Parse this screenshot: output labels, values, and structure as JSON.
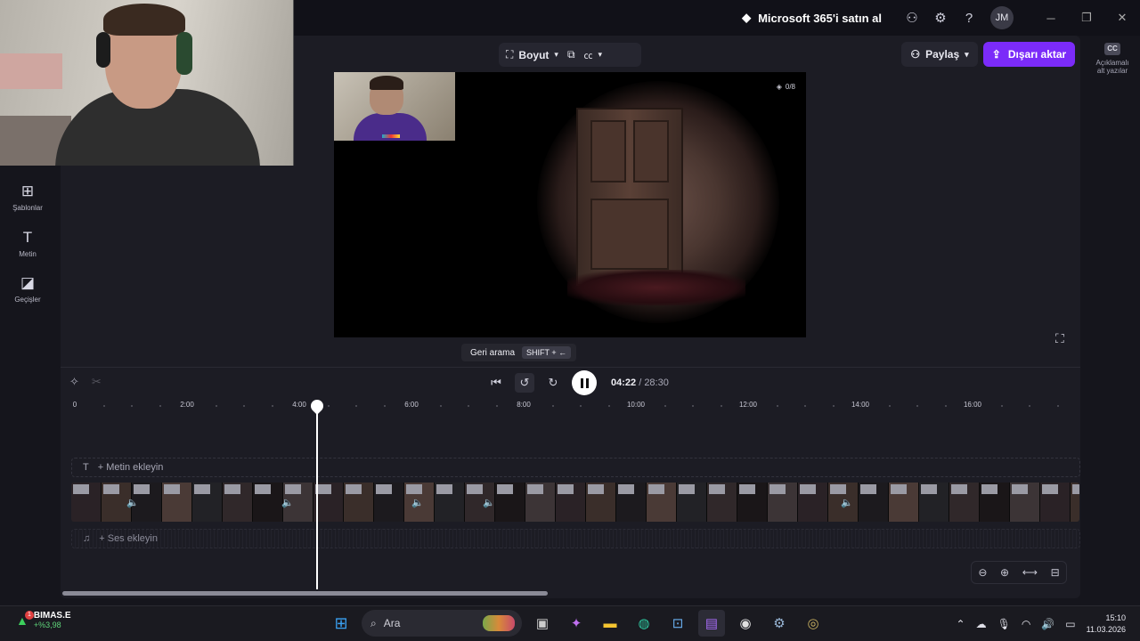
{
  "titlebar": {
    "ms365_label": "Microsoft 365'i satın al",
    "avatar_initials": "JM"
  },
  "rail": {
    "items": [
      {
        "label": "Şablonlar",
        "icon": "templates-icon"
      },
      {
        "label": "Metin",
        "icon": "text-icon"
      },
      {
        "label": "Geçişler",
        "icon": "transitions-icon"
      }
    ]
  },
  "right_rail": {
    "cc_badge": "CC",
    "cc_label": "Açıklamalı alt yazılar"
  },
  "toolbar": {
    "size_label": "Boyut",
    "share_label": "Paylaş",
    "export_label": "Dışarı aktar"
  },
  "preview": {
    "badge_text": "0/8"
  },
  "tooltip": {
    "label": "Geri arama",
    "shortcut": "SHIFT + ←"
  },
  "playback": {
    "current_time": "04:22",
    "duration": "/ 28:30",
    "rewind_seconds": "5",
    "forward_seconds": "5",
    "playhead_position_seconds": 262,
    "total_seconds": 1710
  },
  "ruler": {
    "labels": [
      "0",
      "2:00",
      "4:00",
      "6:00",
      "8:00",
      "10:00",
      "12:00",
      "14:00",
      "16:00"
    ]
  },
  "tracks": {
    "text_placeholder": "+ Metin ekleyin",
    "audio_placeholder": "+ Ses ekleyin"
  },
  "taskbar": {
    "stock_name": "BIMAS.E",
    "stock_change": "+%3,98",
    "stock_badge": "1",
    "search_placeholder": "Ara",
    "time": "15:10",
    "date": "11.03.2026"
  },
  "colors": {
    "accent": "#7b2bf9",
    "background": "#1c1c24"
  }
}
